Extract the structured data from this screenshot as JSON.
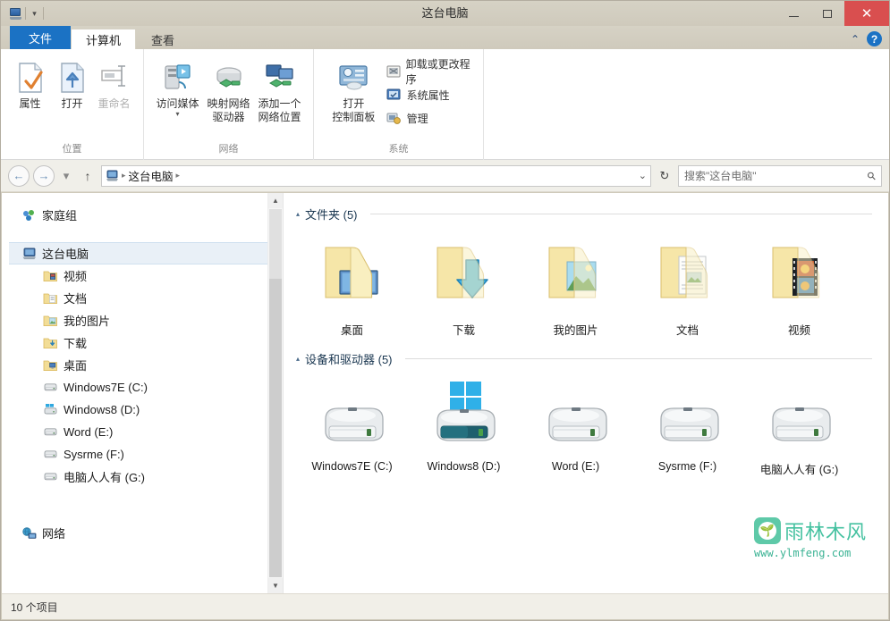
{
  "window": {
    "title": "这台电脑",
    "minimize_label": "—",
    "maximize_label": "□",
    "close_label": "✕",
    "quick_access_caret": "▾"
  },
  "tabs": {
    "file": "文件",
    "items": [
      {
        "label": "计算机",
        "active": true
      },
      {
        "label": "查看",
        "active": false
      }
    ],
    "collapse_icon": "chevron-up-icon",
    "help_label": "?"
  },
  "ribbon": {
    "groups": [
      {
        "label": "位置",
        "buttons": [
          {
            "label": "属性",
            "icon": "properties-icon",
            "dim": false
          },
          {
            "label": "打开",
            "icon": "open-icon",
            "dim": false
          },
          {
            "label": "重命名",
            "icon": "rename-icon",
            "dim": true
          }
        ]
      },
      {
        "label": "网络",
        "buttons": [
          {
            "label": "访问媒体",
            "icon": "media-server-icon",
            "caret": "▾"
          },
          {
            "label": "映射网络\n驱动器",
            "line1": "映射网络",
            "line2": "驱动器",
            "icon": "map-drive-icon",
            "caret": "▾"
          },
          {
            "label": "添加一个\n网络位置",
            "line1": "添加一个",
            "line2": "网络位置",
            "icon": "add-network-location-icon"
          }
        ]
      },
      {
        "label": "系统",
        "big": {
          "line1": "打开",
          "line2": "控制面板",
          "icon": "control-panel-icon"
        },
        "small_items": [
          {
            "label": "卸载或更改程序",
            "icon": "uninstall-program-icon"
          },
          {
            "label": "系统属性",
            "icon": "system-properties-icon"
          },
          {
            "label": "管理",
            "icon": "manage-icon"
          }
        ]
      }
    ]
  },
  "addressbar": {
    "back": "←",
    "forward": "→",
    "history": "▾",
    "up": "↑",
    "breadcrumb_root_icon": "this-pc-icon",
    "breadcrumb": [
      "这台电脑"
    ],
    "separator": "▸",
    "dropdown": "⌄",
    "refresh": "↻"
  },
  "search": {
    "placeholder": "搜索\"这台电脑\"",
    "icon": "search-icon"
  },
  "sidebar": {
    "groups": [
      {
        "items": [
          {
            "label": "家庭组",
            "icon": "homegroup-icon",
            "indent": false,
            "selected": false
          }
        ]
      },
      {
        "items": [
          {
            "label": "这台电脑",
            "icon": "this-pc-icon",
            "indent": false,
            "selected": true
          },
          {
            "label": "视频",
            "icon": "videos-folder-icon",
            "indent": true,
            "selected": false
          },
          {
            "label": "文档",
            "icon": "documents-folder-icon",
            "indent": true,
            "selected": false
          },
          {
            "label": "我的图片",
            "icon": "pictures-folder-icon",
            "indent": true,
            "selected": false
          },
          {
            "label": "下载",
            "icon": "downloads-folder-icon",
            "indent": true,
            "selected": false
          },
          {
            "label": "桌面",
            "icon": "desktop-folder-icon",
            "indent": true,
            "selected": false
          },
          {
            "label": "Windows7E (C:)",
            "icon": "drive-icon",
            "indent": true,
            "selected": false
          },
          {
            "label": "Windows8 (D:)",
            "icon": "windows-drive-icon",
            "indent": true,
            "selected": false
          },
          {
            "label": "Word (E:)",
            "icon": "drive-icon",
            "indent": true,
            "selected": false
          },
          {
            "label": "Sysrme (F:)",
            "icon": "drive-icon",
            "indent": true,
            "selected": false
          },
          {
            "label": "电脑人人有 (G:)",
            "icon": "drive-icon",
            "indent": true,
            "selected": false
          }
        ]
      },
      {
        "items": [
          {
            "label": "网络",
            "icon": "network-icon",
            "indent": false,
            "selected": false
          }
        ]
      }
    ]
  },
  "content": {
    "sections": [
      {
        "title": "文件夹 (5)",
        "caret": "▴",
        "type": "folders",
        "items": [
          {
            "label": "桌面",
            "icon": "desktop-folder-icon"
          },
          {
            "label": "下载",
            "icon": "downloads-folder-icon"
          },
          {
            "label": "我的图片",
            "icon": "pictures-folder-icon"
          },
          {
            "label": "文档",
            "icon": "documents-folder-icon"
          },
          {
            "label": "视频",
            "icon": "videos-folder-icon"
          }
        ]
      },
      {
        "title": "设备和驱动器 (5)",
        "caret": "▴",
        "type": "drives",
        "items": [
          {
            "label": "Windows7E (C:)",
            "icon": "drive-icon",
            "system": false
          },
          {
            "label": "Windows8 (D:)",
            "icon": "windows-drive-icon",
            "system": true
          },
          {
            "label": "Word (E:)",
            "icon": "drive-icon",
            "system": false
          },
          {
            "label": "Sysrme (F:)",
            "icon": "drive-icon",
            "system": false
          },
          {
            "label": "电脑人人有 (G:)",
            "icon": "drive-icon",
            "system": false
          }
        ]
      }
    ]
  },
  "statusbar": {
    "text": "10 个项目"
  },
  "watermark": {
    "name": "雨林木风",
    "url": "www.ylmfeng.com"
  },
  "colors": {
    "accent": "#1b72c4",
    "close": "#d94f4f",
    "folder": "#f5dd94",
    "watermark": "#44c1a0"
  }
}
